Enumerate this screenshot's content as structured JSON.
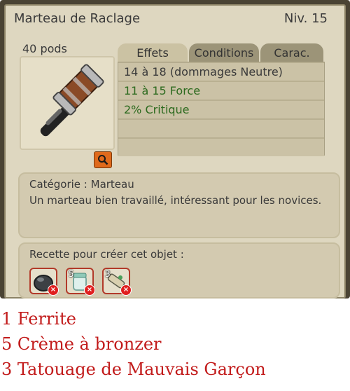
{
  "item": {
    "name": "Marteau de Raclage",
    "level": "Niv. 15",
    "weight": "40 pods"
  },
  "tabs": [
    {
      "label": "Effets"
    },
    {
      "label": "Conditions"
    },
    {
      "label": "Carac."
    }
  ],
  "effects": [
    {
      "text": "14 à 18 (dommages Neutre)",
      "color": "#3a3a3a"
    },
    {
      "text": "11 à 15 Force",
      "color": "#2c6a1e"
    },
    {
      "text": "2% Critique",
      "color": "#2c6a1e"
    }
  ],
  "description": {
    "category": "Catégorie : Marteau",
    "text": "Un marteau bien travaillé, intéressant pour les novices."
  },
  "recipe": {
    "title": "Recette pour créer cet objet :",
    "ingredients": [
      {
        "icon": "ferrite-icon",
        "qty": ""
      },
      {
        "icon": "sunscreen-cream-icon",
        "qty": "5"
      },
      {
        "icon": "tattoo-scroll-icon",
        "qty": "3"
      }
    ]
  },
  "captions": [
    "1 Ferrite",
    "5 Crème à bronzer",
    "3 Tatouage de Mauvais Garçon"
  ]
}
